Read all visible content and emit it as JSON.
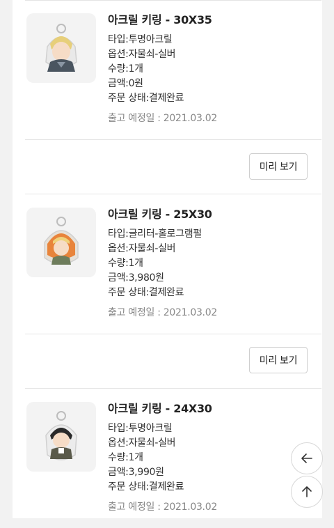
{
  "orders": [
    {
      "title": "아크릴 키링 - 30X35",
      "type": "타입:투명아크릴",
      "option": "옵션:자물쇠-실버",
      "quantity": "수량:1개",
      "amount": "금액:0원",
      "status": "주문 상태:결제완료",
      "ship_date": "출고 예정일 : 2021.03.02",
      "preview_label": "미리 보기"
    },
    {
      "title": "아크릴 키링 - 25X30",
      "type": "타입:글리터-홀로그램펄",
      "option": "옵션:자물쇠-실버",
      "quantity": "수량:1개",
      "amount": "금액:3,980원",
      "status": "주문 상태:결제완료",
      "ship_date": "출고 예정일 : 2021.03.02",
      "preview_label": "미리 보기"
    },
    {
      "title": "아크릴 키링 - 24X30",
      "type": "타입:투명아크릴",
      "option": "옵션:자물쇠-실버",
      "quantity": "수량:1개",
      "amount": "금액:3,990원",
      "status": "주문 상태:결제완료",
      "ship_date": "출고 예정일 : 2021.03.02"
    }
  ],
  "floating": {
    "back_icon": "arrow-left-icon",
    "top_icon": "arrow-up-icon"
  },
  "colors": {
    "background": "#f2f2f2",
    "card": "#ffffff",
    "muted_text": "#888888",
    "border": "#cfcfcf"
  }
}
